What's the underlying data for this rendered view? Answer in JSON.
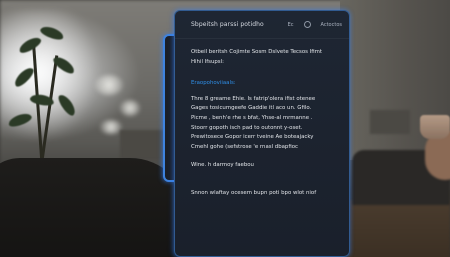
{
  "panel": {
    "title": "Sbpeitsh parssi potidho",
    "toolbar": {
      "btn_a": "Ec",
      "btn_b": "Actoctos"
    },
    "intro_lines": [
      "Otbeil beritsh Cojimte Sosm Dslvete Tecsos Ifimt",
      "Hihil Ifsupsl:"
    ],
    "section_heading": "Eraopohoviiaals:",
    "body_lines": [
      "Thre  8 greame Ehie. Is fatrip'olera ifist otenee",
      "Gages tosicumgeefe Gaddie  itl aco un. Gfilo.",
      "Picme , benh'e rhe s bfat, Yhse-al mrmanne .",
      "Stoorr gopoth isch pad to outonnt y-oset.",
      "Prewitosece Gopor icerr tveine Ae boteajacky",
      "Cmehl gohe  (sefstrose 'e rnasl dbapfioc"
    ],
    "note_line": "Wine. h darmoy faebou",
    "footer_line": "Snnon  wlaftay ocesem  bupn poti bpo wlot niof"
  }
}
